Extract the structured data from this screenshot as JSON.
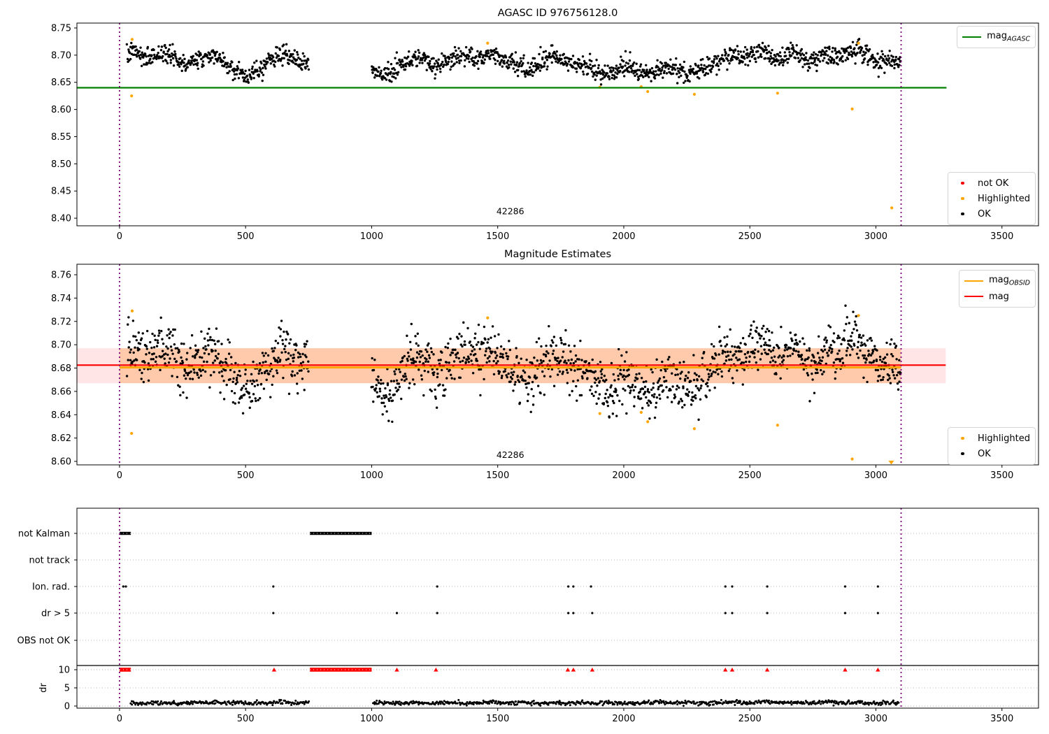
{
  "chart_data": [
    {
      "id": "agasc-mag-plot",
      "type": "scatter",
      "title": "AGASC ID 976756128.0",
      "xlim": [
        -169,
        3645
      ],
      "ylim": [
        8.386,
        8.759
      ],
      "xticks": [
        0,
        500,
        1000,
        1500,
        2000,
        2500,
        3000,
        3500
      ],
      "yticks": [
        8.4,
        8.45,
        8.5,
        8.55,
        8.6,
        8.65,
        8.7,
        8.75
      ],
      "ytick_labels": [
        "8.40",
        "8.45",
        "8.50",
        "8.55",
        "8.60",
        "8.65",
        "8.70",
        "8.75"
      ],
      "vlines": [
        0,
        3100
      ],
      "vline_color": "#800080",
      "ref_lines": [
        {
          "name": "mag_AGASC",
          "color": "#008000",
          "y": 8.64,
          "x0": -169,
          "x1": 3280,
          "width": 2.2
        }
      ],
      "scatter": {
        "color": "#000000",
        "segments": [
          [
            30,
            750
          ],
          [
            1000,
            3100
          ]
        ],
        "step": 1.8,
        "sigma": 0.0085,
        "seed": 7,
        "anchors": [
          [
            30,
            8.7
          ],
          [
            45,
            8.706
          ],
          [
            70,
            8.703
          ],
          [
            100,
            8.695
          ],
          [
            130,
            8.699
          ],
          [
            160,
            8.702
          ],
          [
            190,
            8.703
          ],
          [
            215,
            8.697
          ],
          [
            240,
            8.687
          ],
          [
            265,
            8.683
          ],
          [
            290,
            8.688
          ],
          [
            320,
            8.695
          ],
          [
            345,
            8.7
          ],
          [
            370,
            8.7
          ],
          [
            395,
            8.693
          ],
          [
            420,
            8.683
          ],
          [
            445,
            8.677
          ],
          [
            470,
            8.67
          ],
          [
            495,
            8.663
          ],
          [
            515,
            8.662
          ],
          [
            535,
            8.67
          ],
          [
            560,
            8.678
          ],
          [
            580,
            8.685
          ],
          [
            605,
            8.693
          ],
          [
            630,
            8.699
          ],
          [
            655,
            8.7
          ],
          [
            680,
            8.696
          ],
          [
            705,
            8.69
          ],
          [
            730,
            8.687
          ],
          [
            750,
            8.69
          ],
          [
            1000,
            8.676
          ],
          [
            1020,
            8.669
          ],
          [
            1040,
            8.662
          ],
          [
            1060,
            8.661
          ],
          [
            1080,
            8.668
          ],
          [
            1100,
            8.675
          ],
          [
            1125,
            8.682
          ],
          [
            1150,
            8.69
          ],
          [
            1175,
            8.697
          ],
          [
            1200,
            8.692
          ],
          [
            1225,
            8.685
          ],
          [
            1250,
            8.679
          ],
          [
            1275,
            8.68
          ],
          [
            1300,
            8.687
          ],
          [
            1330,
            8.694
          ],
          [
            1360,
            8.699
          ],
          [
            1390,
            8.7
          ],
          [
            1420,
            8.694
          ],
          [
            1445,
            8.697
          ],
          [
            1470,
            8.702
          ],
          [
            1500,
            8.698
          ],
          [
            1530,
            8.69
          ],
          [
            1560,
            8.683
          ],
          [
            1590,
            8.678
          ],
          [
            1615,
            8.673
          ],
          [
            1640,
            8.679
          ],
          [
            1665,
            8.687
          ],
          [
            1690,
            8.694
          ],
          [
            1715,
            8.7
          ],
          [
            1740,
            8.696
          ],
          [
            1770,
            8.69
          ],
          [
            1800,
            8.684
          ],
          [
            1830,
            8.68
          ],
          [
            1860,
            8.677
          ],
          [
            1890,
            8.673
          ],
          [
            1920,
            8.668
          ],
          [
            1950,
            8.667
          ],
          [
            1980,
            8.673
          ],
          [
            2010,
            8.679
          ],
          [
            2040,
            8.674
          ],
          [
            2070,
            8.667
          ],
          [
            2100,
            8.663
          ],
          [
            2130,
            8.668
          ],
          [
            2160,
            8.675
          ],
          [
            2190,
            8.677
          ],
          [
            2220,
            8.671
          ],
          [
            2250,
            8.667
          ],
          [
            2280,
            8.671
          ],
          [
            2310,
            8.677
          ],
          [
            2340,
            8.682
          ],
          [
            2370,
            8.69
          ],
          [
            2400,
            8.697
          ],
          [
            2430,
            8.699
          ],
          [
            2460,
            8.695
          ],
          [
            2490,
            8.699
          ],
          [
            2520,
            8.704
          ],
          [
            2550,
            8.706
          ],
          [
            2580,
            8.699
          ],
          [
            2610,
            8.691
          ],
          [
            2640,
            8.699
          ],
          [
            2665,
            8.706
          ],
          [
            2690,
            8.701
          ],
          [
            2715,
            8.694
          ],
          [
            2740,
            8.687
          ],
          [
            2765,
            8.692
          ],
          [
            2790,
            8.699
          ],
          [
            2815,
            8.702
          ],
          [
            2840,
            8.696
          ],
          [
            2865,
            8.699
          ],
          [
            2890,
            8.703
          ],
          [
            2915,
            8.708
          ],
          [
            2940,
            8.71
          ],
          [
            2965,
            8.701
          ],
          [
            2990,
            8.693
          ],
          [
            3015,
            8.686
          ],
          [
            3040,
            8.689
          ],
          [
            3065,
            8.692
          ],
          [
            3085,
            8.688
          ],
          [
            3100,
            8.686
          ]
        ]
      },
      "highlighted_color": "#ffa500",
      "highlighted": [
        [
          48,
          8.625
        ],
        [
          50,
          8.729
        ],
        [
          1460,
          8.722
        ],
        [
          1905,
          8.641
        ],
        [
          2069,
          8.642
        ],
        [
          2095,
          8.633
        ],
        [
          2280,
          8.628
        ],
        [
          2610,
          8.63
        ],
        [
          2906,
          8.601
        ],
        [
          2931,
          8.722
        ],
        [
          3063,
          8.419
        ]
      ],
      "annotation": {
        "text": "42286",
        "x": 1550,
        "y": 8.407
      },
      "legends": [
        {
          "pos": "upper-right",
          "entries": [
            {
              "type": "line",
              "color": "#008000",
              "label": "mag",
              "sub": "AGASC"
            }
          ]
        },
        {
          "pos": "lower-right",
          "entries": [
            {
              "type": "dot",
              "color": "#ff0000",
              "label": "not OK"
            },
            {
              "type": "dot",
              "color": "#ffa500",
              "label": "Highlighted"
            },
            {
              "type": "dot",
              "color": "#000000",
              "label": "OK"
            }
          ]
        }
      ]
    },
    {
      "id": "magnitude-estimates-plot",
      "type": "scatter",
      "title": "Magnitude Estimates",
      "xlim": [
        -169,
        3645
      ],
      "ylim": [
        8.597,
        8.769
      ],
      "xticks": [
        0,
        500,
        1000,
        1500,
        2000,
        2500,
        3000,
        3500
      ],
      "yticks": [
        8.6,
        8.62,
        8.64,
        8.66,
        8.68,
        8.7,
        8.72,
        8.74,
        8.76
      ],
      "ytick_labels": [
        "8.60",
        "8.62",
        "8.64",
        "8.66",
        "8.68",
        "8.70",
        "8.72",
        "8.74",
        "8.76"
      ],
      "vlines": [
        0,
        3100
      ],
      "vline_color": "#800080",
      "bands": [
        {
          "name": "mag-uncertainty-band-full",
          "x0": -169,
          "x1": 3277,
          "y0": 8.667,
          "y1": 8.697,
          "color": "rgba(255,0,0,0.10)"
        },
        {
          "name": "obsid-band",
          "x0": 0,
          "x1": 3100,
          "y0": 8.667,
          "y1": 8.697,
          "color": "rgba(255,127,14,0.27)"
        }
      ],
      "ref_lines": [
        {
          "name": "mag_OBSID",
          "color": "#ffa500",
          "y": 8.6805,
          "x0": 0,
          "x1": 3100,
          "width": 3
        },
        {
          "name": "mag",
          "color": "#ff0000",
          "y": 8.6825,
          "x0": -169,
          "x1": 3277,
          "width": 2.2
        }
      ],
      "scatter": {
        "color": "#000000",
        "segments": [
          [
            30,
            750
          ],
          [
            1000,
            3100
          ]
        ],
        "step": 1.8,
        "sigma": 0.011,
        "seed": 12,
        "anchors_ref": 0,
        "anchor_offset": -0.005
      },
      "highlighted_color": "#ffa500",
      "highlighted": [
        [
          48,
          8.624
        ],
        [
          50,
          8.729
        ],
        [
          1460,
          8.723
        ],
        [
          1905,
          8.641
        ],
        [
          2069,
          8.642
        ],
        [
          2095,
          8.634
        ],
        [
          2280,
          8.628
        ],
        [
          2610,
          8.631
        ],
        [
          2906,
          8.602
        ],
        [
          2931,
          8.725
        ]
      ],
      "clipped_highlighted": [
        {
          "x": 3061,
          "edge": "bottom"
        }
      ],
      "annotation": {
        "text": "42286",
        "x": 1550,
        "y": 8.603
      },
      "legends": [
        {
          "pos": "upper-right",
          "entries": [
            {
              "type": "line",
              "color": "#ffa500",
              "label": "mag",
              "sub": "OBSID"
            },
            {
              "type": "line",
              "color": "#ff0000",
              "label": "mag",
              "sub": ""
            }
          ]
        },
        {
          "pos": "lower-right",
          "entries": [
            {
              "type": "dot",
              "color": "#ffa500",
              "label": "Highlighted"
            },
            {
              "type": "dot",
              "color": "#000000",
              "label": "OK"
            }
          ]
        }
      ]
    },
    {
      "id": "flags-dr-plot",
      "type": "flags",
      "xlim": [
        -169,
        3645
      ],
      "xticks": [
        0,
        500,
        1000,
        1500,
        2000,
        2500,
        3000,
        3500
      ],
      "vlines": [
        0,
        3100
      ],
      "vline_color": "#800080",
      "grid_color": "#bbbbbb",
      "flag_rows": [
        {
          "label": "not Kalman",
          "runs": [
            [
              0,
              45
            ],
            [
              755,
              1000
            ]
          ],
          "points": []
        },
        {
          "label": "not track",
          "runs": [],
          "points": []
        },
        {
          "label": "Ion. rad.",
          "runs": [],
          "points": [
            15,
            25,
            610,
            1260,
            1780,
            1800,
            1870,
            2403,
            2430,
            2569,
            2878,
            3008
          ]
        },
        {
          "label": "dr > 5",
          "runs": [],
          "points": [
            610,
            1100,
            1260,
            1780,
            1800,
            1875,
            2403,
            2430,
            2569,
            2878,
            3008
          ]
        },
        {
          "label": "OBS not OK",
          "runs": [],
          "points": []
        }
      ],
      "dr_axis": {
        "label": "dr",
        "ticks": [
          0,
          5,
          10
        ],
        "clip_color": "#ff0000",
        "red_runs": [
          [
            0,
            45
          ],
          [
            755,
            1000
          ]
        ],
        "red_points": [
          613,
          1100,
          1255,
          1778,
          1800,
          1875,
          2403,
          2430,
          2569,
          2878,
          3008
        ],
        "scatter": {
          "color": "#000000",
          "segments": [
            [
              45,
              750
            ],
            [
              1005,
              3090
            ]
          ],
          "step": 3,
          "sigma": 0.28,
          "seed": 99,
          "clamp": [
            0.05,
            2.6
          ],
          "anchors": [
            [
              45,
              0.9
            ],
            [
              100,
              0.7
            ],
            [
              160,
              0.9
            ],
            [
              220,
              0.7
            ],
            [
              280,
              1.0
            ],
            [
              330,
              0.8
            ],
            [
              380,
              1.1
            ],
            [
              430,
              0.8
            ],
            [
              480,
              1.0
            ],
            [
              530,
              0.7
            ],
            [
              580,
              0.9
            ],
            [
              640,
              1.1
            ],
            [
              700,
              0.8
            ],
            [
              750,
              0.9
            ],
            [
              1005,
              0.8
            ],
            [
              1060,
              1.0
            ],
            [
              1120,
              0.7
            ],
            [
              1180,
              1.0
            ],
            [
              1240,
              0.8
            ],
            [
              1300,
              1.0
            ],
            [
              1360,
              0.7
            ],
            [
              1420,
              0.9
            ],
            [
              1480,
              1.1
            ],
            [
              1540,
              0.8
            ],
            [
              1600,
              1.0
            ],
            [
              1660,
              0.7
            ],
            [
              1720,
              0.9
            ],
            [
              1780,
              0.7
            ],
            [
              1840,
              1.0
            ],
            [
              1900,
              0.8
            ],
            [
              1960,
              1.0
            ],
            [
              2020,
              0.7
            ],
            [
              2080,
              0.9
            ],
            [
              2140,
              1.2
            ],
            [
              2200,
              0.8
            ],
            [
              2260,
              1.0
            ],
            [
              2320,
              0.7
            ],
            [
              2380,
              0.9
            ],
            [
              2440,
              1.1
            ],
            [
              2500,
              0.8
            ],
            [
              2560,
              1.3
            ],
            [
              2620,
              0.9
            ],
            [
              2680,
              1.0
            ],
            [
              2740,
              0.8
            ],
            [
              2800,
              1.1
            ],
            [
              2860,
              0.8
            ],
            [
              2920,
              1.0
            ],
            [
              2980,
              0.7
            ],
            [
              3040,
              0.9
            ],
            [
              3090,
              0.8
            ]
          ]
        }
      }
    }
  ]
}
